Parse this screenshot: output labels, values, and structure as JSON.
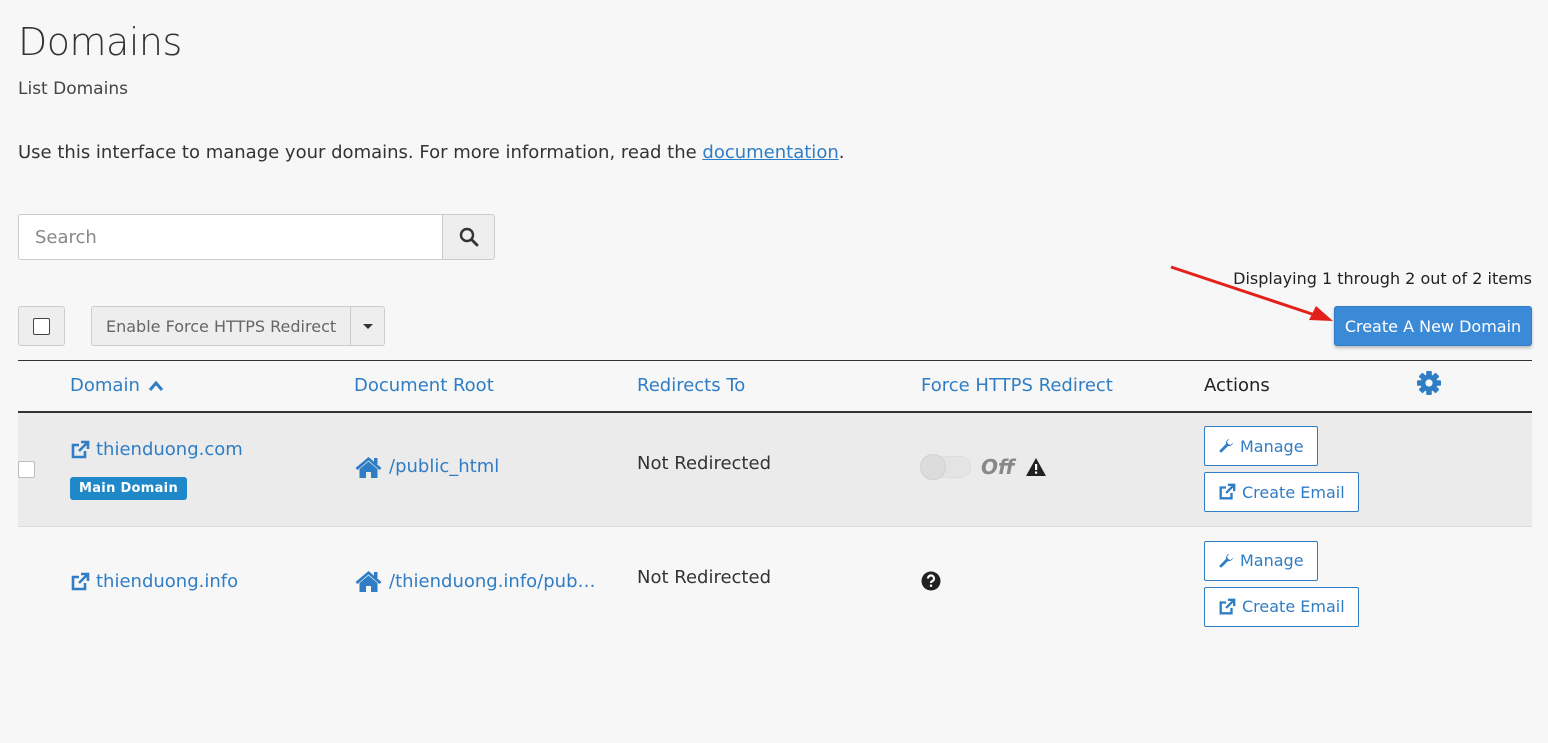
{
  "header": {
    "title": "Domains",
    "subtitle": "List Domains",
    "intro_text": "Use this interface to manage your domains. For more information, read the ",
    "intro_link": "documentation",
    "intro_end": "."
  },
  "search": {
    "placeholder": "Search"
  },
  "pagination": {
    "summary": "Displaying 1 through 2 out of 2 items"
  },
  "toolbar": {
    "bulk_action_label": "Enable Force HTTPS Redirect",
    "create_label": "Create A New Domain"
  },
  "table": {
    "columns": {
      "domain": "Domain",
      "docroot": "Document Root",
      "redirects": "Redirects To",
      "https": "Force HTTPS Redirect",
      "actions": "Actions"
    },
    "rows": [
      {
        "domain": "thienduong.com",
        "badge": "Main Domain",
        "docroot": "/public_html",
        "redirects": "Not Redirected",
        "https_state": "Off",
        "manage_label": "Manage",
        "email_label": "Create Email"
      },
      {
        "domain": "thienduong.info",
        "docroot": "/thienduong.info/pub…",
        "redirects": "Not Redirected",
        "manage_label": "Manage",
        "email_label": "Create Email"
      }
    ]
  },
  "colors": {
    "accent": "#2f7dc4",
    "primary_button": "#3b8ad8",
    "badge": "#1e88c9",
    "annotation_arrow": "#e3201b"
  }
}
